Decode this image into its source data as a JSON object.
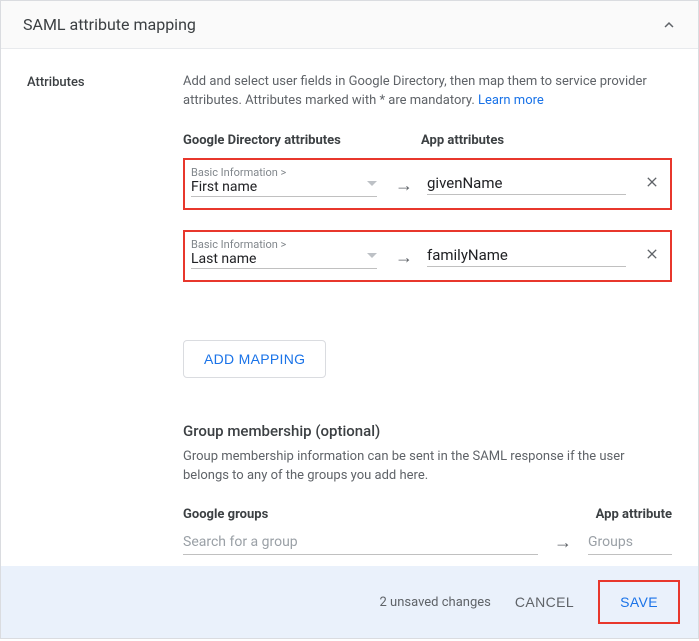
{
  "header": {
    "title": "SAML attribute mapping"
  },
  "section_label": "Attributes",
  "description": {
    "text": "Add and select user fields in Google Directory, then map them to service provider attributes. Attributes marked with * are mandatory. ",
    "link": "Learn more"
  },
  "columns": {
    "directory": "Google Directory attributes",
    "app": "App attributes"
  },
  "mappings": [
    {
      "breadcrumb": "Basic Information >",
      "dir_value": "First name",
      "app_value": "givenName"
    },
    {
      "breadcrumb": "Basic Information >",
      "dir_value": "Last name",
      "app_value": "familyName"
    }
  ],
  "add_mapping_label": "ADD MAPPING",
  "group": {
    "title": "Group membership (optional)",
    "desc": "Group membership information can be sent in the SAML response if the user belongs to any of the groups you add here.",
    "col_groups": "Google groups",
    "col_app": "App attribute",
    "search_placeholder": "Search for a group",
    "app_value": "Groups"
  },
  "footer": {
    "unsaved": "2 unsaved changes",
    "cancel": "CANCEL",
    "save": "SAVE"
  }
}
